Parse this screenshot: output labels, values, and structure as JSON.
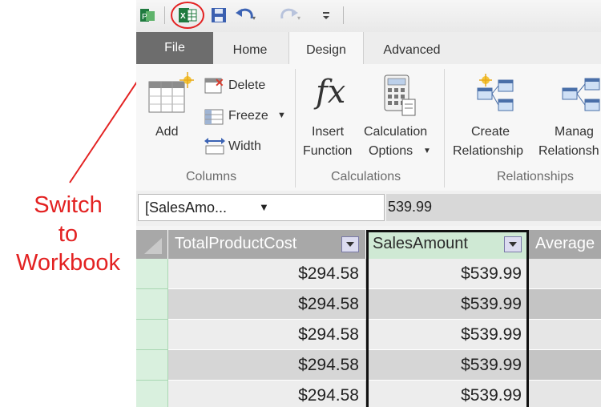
{
  "annotation": {
    "lines": [
      "Switch",
      "to",
      "Workbook"
    ],
    "color": "#e32222"
  },
  "quick_access": {
    "icons": [
      "powerpivot-icon",
      "switch-to-workbook-icon",
      "save-icon",
      "undo-icon",
      "redo-icon",
      "customize-icon"
    ]
  },
  "tabs": [
    {
      "label": "File"
    },
    {
      "label": "Home"
    },
    {
      "label": "Design"
    },
    {
      "label": "Advanced"
    }
  ],
  "ribbon": {
    "columns": {
      "add_label": "Add",
      "delete_label": "Delete",
      "freeze_label": "Freeze",
      "width_label": "Width",
      "group_label": "Columns"
    },
    "calculations": {
      "insert_function_line1": "Insert",
      "insert_function_line2": "Function",
      "calc_options_line1": "Calculation",
      "calc_options_line2": "Options",
      "group_label": "Calculations"
    },
    "relationships": {
      "create_line1": "Create",
      "create_line2": "Relationship",
      "manage_line1": "Manag",
      "manage_line2": "Relationsh",
      "group_label": "Relationships"
    }
  },
  "formula_bar": {
    "name_box": "[SalesAmo...",
    "value": "539.99"
  },
  "grid": {
    "columns": [
      "TotalProductCost",
      "SalesAmount",
      "Average"
    ],
    "rows": [
      [
        "$294.58",
        "$539.99"
      ],
      [
        "$294.58",
        "$539.99"
      ],
      [
        "$294.58",
        "$539.99"
      ],
      [
        "$294.58",
        "$539.99"
      ],
      [
        "$294.58",
        "$539.99"
      ]
    ]
  },
  "colors": {
    "selected_header": "#cfe9d4",
    "row_header": "#d9f0de",
    "header": "#a8a8a8",
    "file_tab": "#6d6d6d"
  }
}
